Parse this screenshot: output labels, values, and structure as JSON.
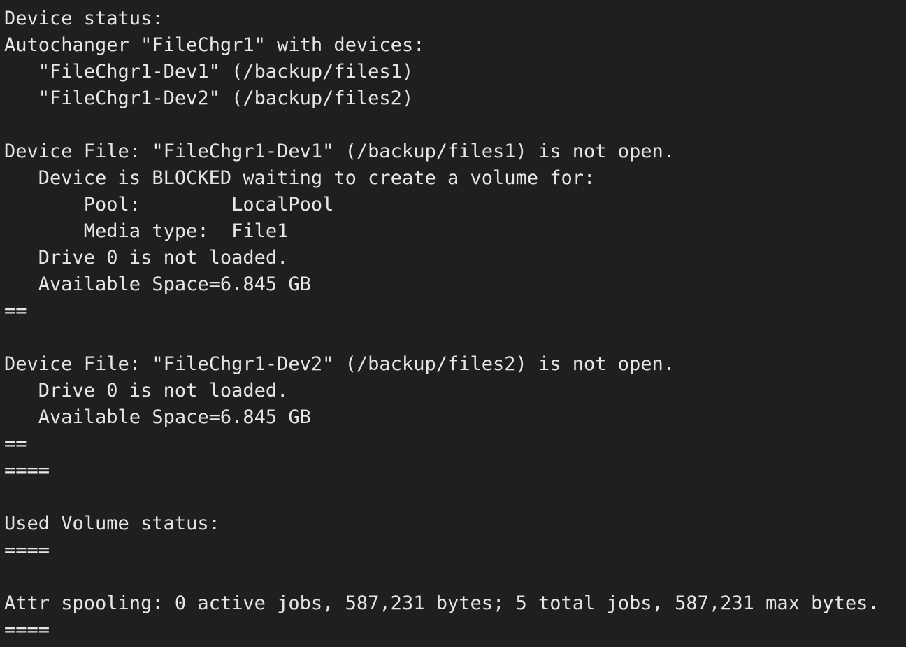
{
  "terminal": {
    "background": "#1f1f1f",
    "foreground": "#e6e6e6",
    "lines": [
      "Device status:",
      "Autochanger \"FileChgr1\" with devices:",
      "   \"FileChgr1-Dev1\" (/backup/files1)",
      "   \"FileChgr1-Dev2\" (/backup/files2)",
      "",
      "Device File: \"FileChgr1-Dev1\" (/backup/files1) is not open.",
      "   Device is BLOCKED waiting to create a volume for:",
      "       Pool:        LocalPool",
      "       Media type:  File1",
      "   Drive 0 is not loaded.",
      "   Available Space=6.845 GB",
      "==",
      "",
      "Device File: \"FileChgr1-Dev2\" (/backup/files2) is not open.",
      "   Drive 0 is not loaded.",
      "   Available Space=6.845 GB",
      "==",
      "====",
      "",
      "Used Volume status:",
      "====",
      "",
      "Attr spooling: 0 active jobs, 587,231 bytes; 5 total jobs, 587,231 max bytes.",
      "===="
    ]
  }
}
